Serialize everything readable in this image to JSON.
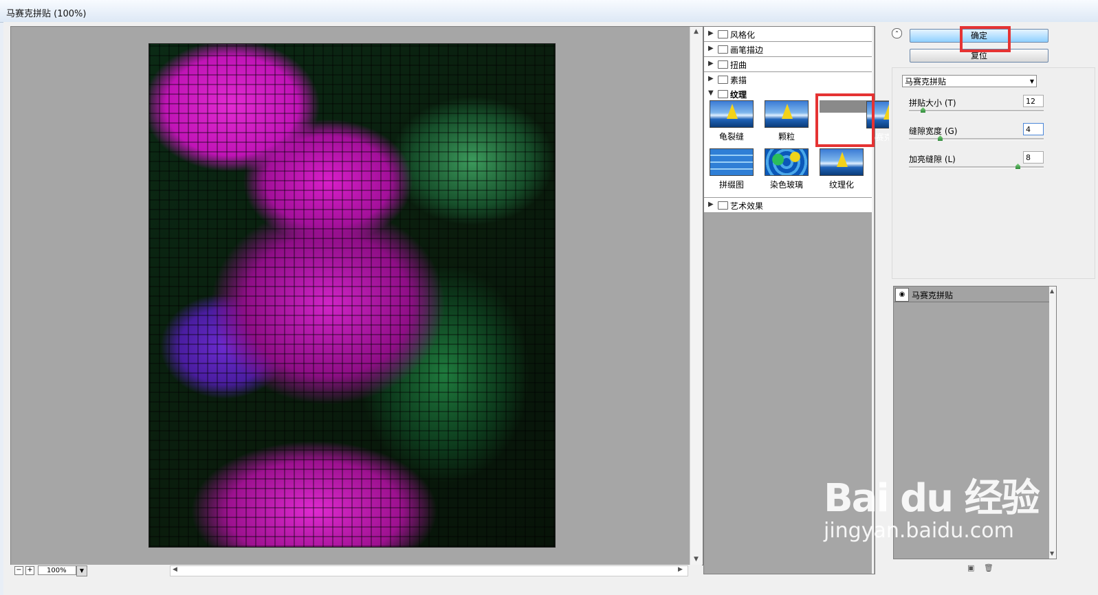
{
  "window": {
    "title": "马赛克拼贴 (100%)"
  },
  "preview": {
    "zoom": "100%",
    "zoom_out": "−",
    "zoom_in": "+"
  },
  "gallery": {
    "categories": [
      {
        "label": "风格化",
        "expanded": false
      },
      {
        "label": "画笔描边",
        "expanded": false
      },
      {
        "label": "扭曲",
        "expanded": false
      },
      {
        "label": "素描",
        "expanded": false
      },
      {
        "label": "纹理",
        "expanded": true
      },
      {
        "label": "艺术效果",
        "expanded": false
      }
    ],
    "texture_filters": [
      "龟裂缝",
      "颗粒",
      "马赛克拼贴",
      "拼缀图",
      "染色玻璃",
      "纹理化"
    ],
    "selected_filter": "马赛克拼贴"
  },
  "panel": {
    "ok_label": "确定",
    "reset_label": "复位",
    "filter_select": "马赛克拼贴",
    "params": [
      {
        "label": "拼贴大小 (T)",
        "value": "12",
        "fraction": 0.1
      },
      {
        "label": "缝隙宽度 (G)",
        "value": "4",
        "fraction": 0.23
      },
      {
        "label": "加亮缝隙 (L)",
        "value": "8",
        "fraction": 0.8
      }
    ]
  },
  "layers": [
    {
      "name": "马赛克拼贴"
    }
  ],
  "watermark": {
    "brand": "Bai du 经验",
    "url": "jingyan.baidu.com"
  },
  "colors": {
    "highlight": "#e53333",
    "ok_button": "#8fd0ff",
    "gallery_bg": "#a6a6a6"
  }
}
